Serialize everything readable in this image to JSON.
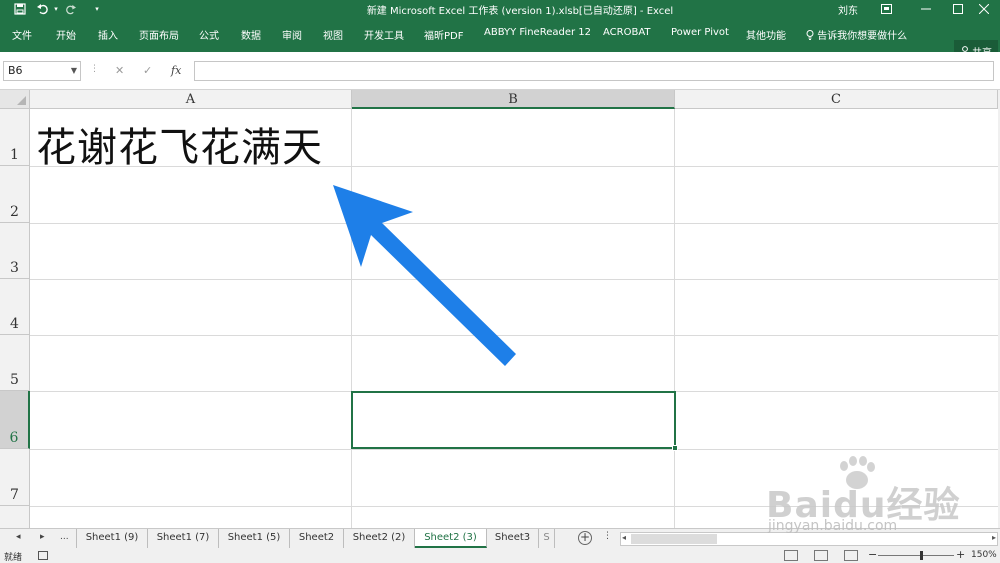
{
  "title": "新建 Microsoft Excel 工作表 (version 1).xlsb[已自动还原]  -  Excel",
  "user": "刘东",
  "ribbon_tabs": [
    "文件",
    "开始",
    "插入",
    "页面布局",
    "公式",
    "数据",
    "审阅",
    "视图",
    "开发工具",
    "福昕PDF",
    "ABBYY FineReader 12",
    "ACROBAT",
    "Power Pivot",
    "其他功能"
  ],
  "tell_me": "告诉我你想要做什么",
  "share": "共享",
  "formula_bar": {
    "name_box": "B6",
    "cancel": "✕",
    "enter": "✓",
    "fx": "fx",
    "value": ""
  },
  "columns": [
    "A",
    "B",
    "C"
  ],
  "selected_column": "B",
  "rows": [
    "1",
    "2",
    "3",
    "4",
    "5",
    "6",
    "7"
  ],
  "selected_row": "6",
  "cells": {
    "A1": "花谢花飞花满天"
  },
  "arrow_color": "#1e7fe8",
  "sheet_nav": {
    "prev": "◂",
    "next": "▸",
    "more": "..."
  },
  "sheet_tabs": [
    "Sheet1 (9)",
    "Sheet1 (7)",
    "Sheet1 (5)",
    "Sheet2",
    "Sheet2 (2)",
    "Sheet2 (3)",
    "Sheet3",
    "S"
  ],
  "active_sheet": "Sheet2 (3)",
  "status": {
    "ready": "就绪",
    "zoom": "150%"
  },
  "watermark": {
    "brand": "Baidu经验",
    "url": "jingyan.baidu.com"
  },
  "colors": {
    "accent": "#217346"
  }
}
